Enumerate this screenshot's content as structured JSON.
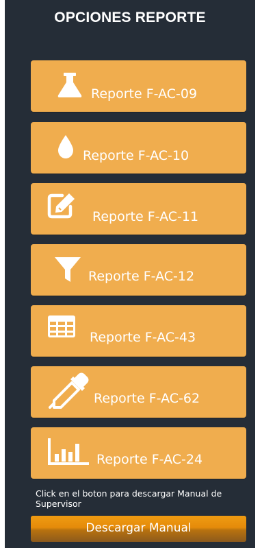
{
  "panel": {
    "title": "OPCIONES REPORTE"
  },
  "reports": [
    {
      "label": "Reporte F-AC-09",
      "icon": "flask-icon"
    },
    {
      "label": "Reporte F-AC-10",
      "icon": "drop-icon"
    },
    {
      "label": "Reporte F-AC-11",
      "icon": "edit-icon"
    },
    {
      "label": "Reporte F-AC-12",
      "icon": "filter-icon"
    },
    {
      "label": "Reporte F-AC-43",
      "icon": "table-icon"
    },
    {
      "label": "Reporte F-AC-62",
      "icon": "eyedropper-icon"
    },
    {
      "label": "Reporte F-AC-24",
      "icon": "bar-chart-icon"
    }
  ],
  "help": {
    "text": "Click en el boton para descargar Manual de Supervisor"
  },
  "download": {
    "label": "Descargar Manual"
  },
  "colors": {
    "panel_bg": "#252d37",
    "button_bg": "#f0ad4e",
    "download_bg": "#e58b0a",
    "text": "#ffffff"
  }
}
